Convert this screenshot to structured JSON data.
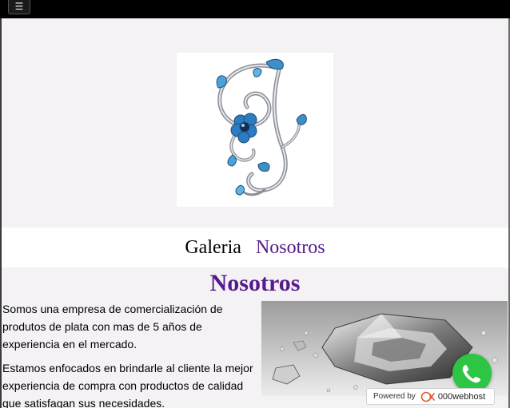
{
  "nav": {
    "menu_icon": "hamburger-menu-icon",
    "menu_glyph": "☰",
    "links": [
      {
        "label": "Galeria"
      },
      {
        "label": "Nosotros"
      }
    ]
  },
  "logo": {
    "icon": "silver-ornament-with-blue-flower-logo"
  },
  "about": {
    "title": "Nosotros",
    "paragraphs": [
      "Somos una empresa de comercialización de produtos de plata con mas de 5 años de experiencia en el mercado.",
      "Estamos enfocados en brindarle al cliente la mejor experiencia de compra con productos de calidad que satisfagan sus necesidades."
    ],
    "image": "crystal-gemstones-photo"
  },
  "whatsapp": {
    "icon": "whatsapp-phone-icon"
  },
  "badge": {
    "powered_label": "Powered by",
    "brand": "000webhost",
    "icon": "000webhost-logo-icon"
  },
  "colors": {
    "visited_link": "#551a8b",
    "topbar": "#000000",
    "whatsapp": "#2fc544"
  }
}
